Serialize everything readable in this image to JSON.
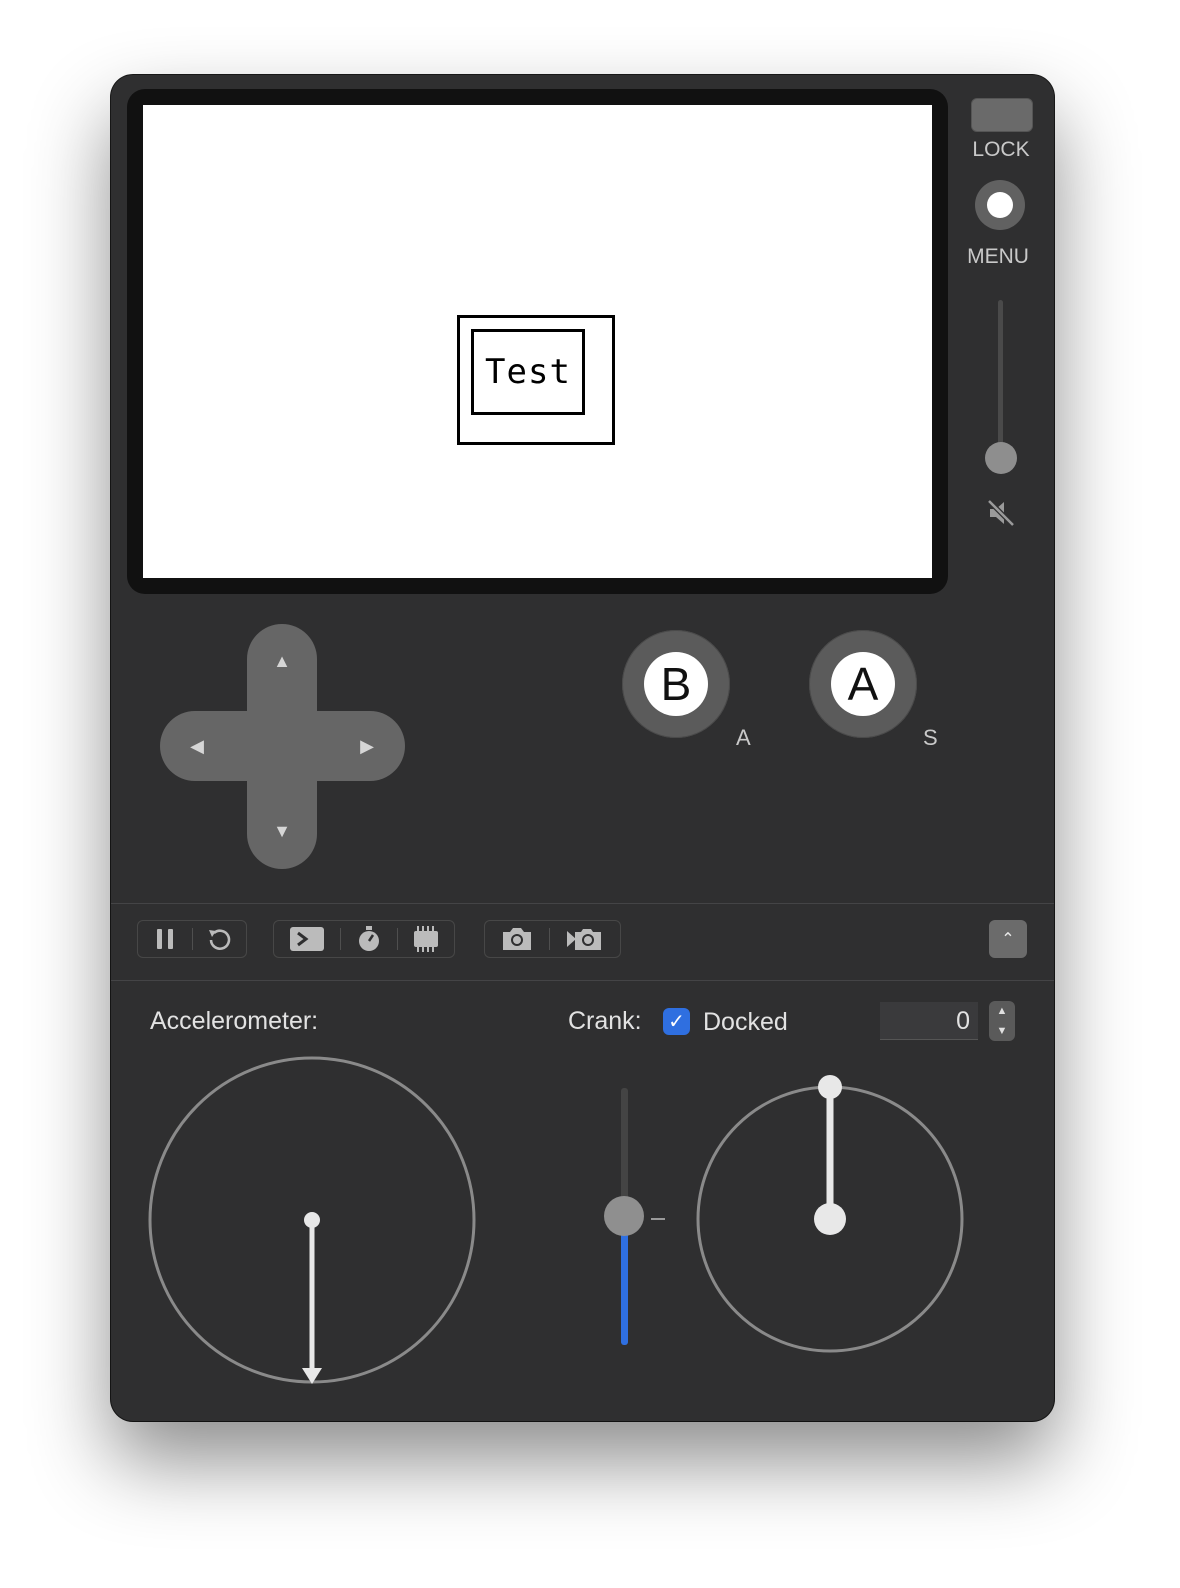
{
  "screen": {
    "text": "Test"
  },
  "side": {
    "lock_label": "LOCK",
    "menu_label": "MENU",
    "volume_level": 0
  },
  "dpad": {
    "up": "▲",
    "down": "▼",
    "left": "◀",
    "right": "▶"
  },
  "buttons": {
    "b": {
      "label": "B",
      "key": "A"
    },
    "a": {
      "label": "A",
      "key": "S"
    }
  },
  "toolbar": {
    "groups": [
      [
        "pause-icon",
        "restart-icon"
      ],
      [
        "console-icon",
        "stopwatch-icon",
        "chip-icon"
      ],
      [
        "camera-icon",
        "record-video-icon"
      ]
    ],
    "collapse_glyph": "⌃"
  },
  "accelerometer": {
    "label": "Accelerometer:"
  },
  "crank": {
    "label": "Crank:",
    "docked_label": "Docked",
    "docked": true,
    "checkmark": "✓",
    "angle_value": "0",
    "stepper_up": "▲",
    "stepper_down": "▼",
    "accent_color": "#2f6fe0"
  }
}
